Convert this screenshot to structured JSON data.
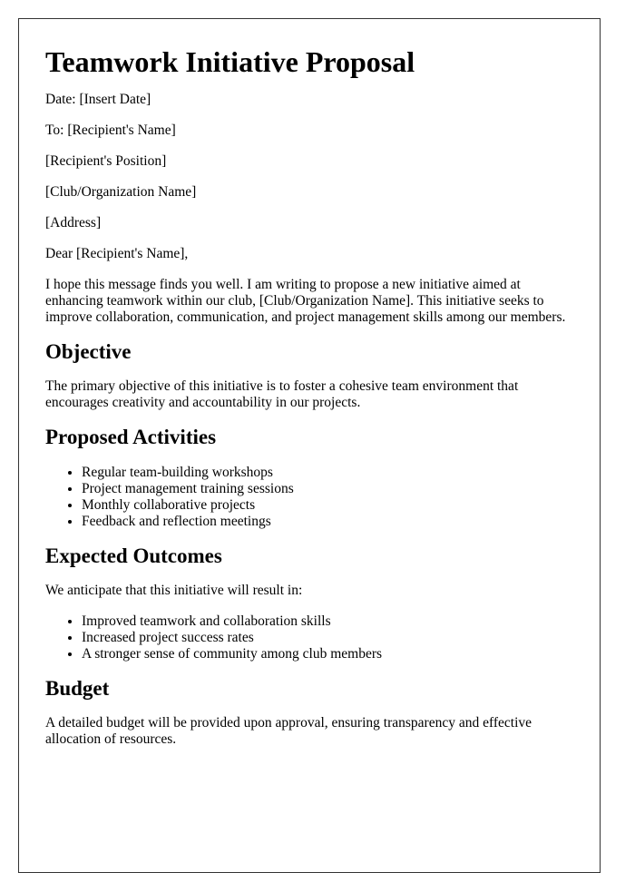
{
  "document": {
    "title": "Teamwork Initiative Proposal",
    "meta": {
      "date": "Date: [Insert Date]",
      "to": "To: [Recipient's Name]",
      "position": "[Recipient's Position]",
      "organization": "[Club/Organization Name]",
      "address": "[Address]",
      "salutation": "Dear [Recipient's Name],"
    },
    "intro": "I hope this message finds you well. I am writing to propose a new initiative aimed at enhancing teamwork within our club, [Club/Organization Name]. This initiative seeks to improve collaboration, communication, and project management skills among our members.",
    "sections": {
      "objective": {
        "heading": "Objective",
        "text": "The primary objective of this initiative is to foster a cohesive team environment that encourages creativity and accountability in our projects."
      },
      "activities": {
        "heading": "Proposed Activities",
        "items": [
          "Regular team-building workshops",
          "Project management training sessions",
          "Monthly collaborative projects",
          "Feedback and reflection meetings"
        ]
      },
      "outcomes": {
        "heading": "Expected Outcomes",
        "text": "We anticipate that this initiative will result in:",
        "items": [
          "Improved teamwork and collaboration skills",
          "Increased project success rates",
          "A stronger sense of community among club members"
        ]
      },
      "budget": {
        "heading": "Budget",
        "text": "A detailed budget will be provided upon approval, ensuring transparency and effective allocation of resources."
      }
    }
  }
}
